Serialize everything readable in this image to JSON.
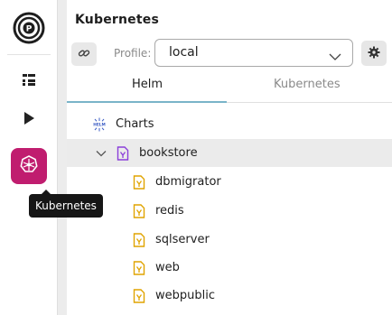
{
  "activity_bar": {
    "items": [
      {
        "name": "explorer",
        "icon": "tree-view-icon",
        "active": false
      },
      {
        "name": "run",
        "icon": "play-icon",
        "active": false
      },
      {
        "name": "kubernetes",
        "icon": "helm-wheel-icon",
        "active": true
      }
    ],
    "accent": "#c01d6f"
  },
  "tooltip": {
    "text": "Kubernetes"
  },
  "panel": {
    "title": "Kubernetes",
    "profile_label": "Profile:",
    "profile_value": "local",
    "tabs": [
      {
        "label": "Helm",
        "active": true
      },
      {
        "label": "Kubernetes",
        "active": false
      }
    ]
  },
  "tree": {
    "root_label": "Charts",
    "chart": {
      "label": "bookstore",
      "expanded": true
    },
    "children": [
      "dbmigrator",
      "redis",
      "sqlserver",
      "web",
      "webpublic"
    ]
  },
  "colors": {
    "helm_icon": "#3b5cc4",
    "chart_icon": "#8b3fd9",
    "file_icon": "#e0a400",
    "tab_underline": "#79b4c9"
  }
}
